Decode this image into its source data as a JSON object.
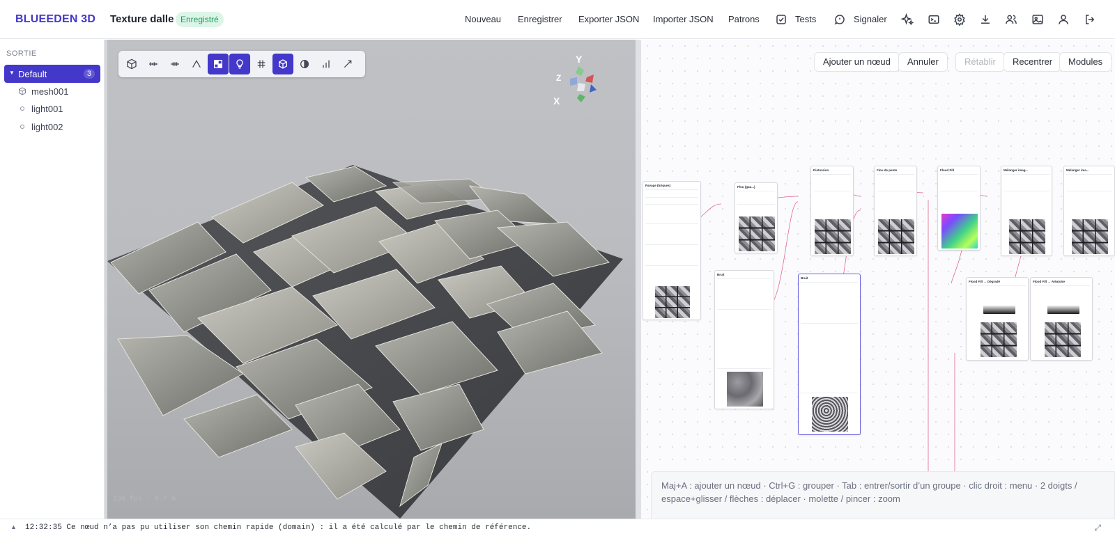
{
  "app": {
    "brand": "BLUEEDEN 3D",
    "document_title": "Texture dalle",
    "save_status": "Enregistré"
  },
  "menu": {
    "items": [
      "Nouveau",
      "Enregistrer",
      "Exporter JSON",
      "Importer JSON",
      "Patrons"
    ],
    "tests_label": "Tests",
    "report_label": "Signaler"
  },
  "toolbar_icons": [
    "sparkles-icon",
    "terminal-icon",
    "gear-icon",
    "download-icon",
    "users-icon",
    "image-icon",
    "user-icon",
    "logout-icon"
  ],
  "sidebar": {
    "section_label": "SORTIE",
    "scene": {
      "name": "Default",
      "count": "3"
    },
    "items": [
      {
        "label": "mesh001",
        "icon": "cube-icon"
      },
      {
        "label": "light001",
        "icon": "light-dot-icon"
      },
      {
        "label": "light002",
        "icon": "light-dot-icon"
      }
    ]
  },
  "viewport": {
    "tools": [
      "cube-icon",
      "ruler-icon",
      "grid-lines-icon",
      "angle-icon",
      "checker-icon",
      "bulb-icon",
      "grid-icon",
      "box-icon",
      "contrast-icon",
      "bars-icon",
      "diagonal-icon"
    ],
    "active_tools": [
      "checker-icon",
      "bulb-icon",
      "box-icon"
    ],
    "gizmo": {
      "x": "X",
      "y": "Y",
      "z": "Z"
    },
    "status_text": "130 fps · 0.7 m"
  },
  "graph": {
    "buttons": {
      "add": "Ajouter un nœud",
      "undo": "Annuler",
      "redo": "Rétablir",
      "recenter": "Recentrer",
      "modules": "Modules"
    },
    "hint": "Maj+A : ajouter un nœud · Ctrl+G : grouper · Tab : entrer/sortir d’un groupe · clic droit : menu · 2 doigts / espace+glisser / flèches : déplacer · molette / pincer : zoom",
    "nodes": [
      {
        "title": "Pavage (briques)"
      },
      {
        "title": "Flou (gau...)"
      },
      {
        "title": "Distorsion"
      },
      {
        "title": "Flou de pente"
      },
      {
        "title": "Flood Fill"
      },
      {
        "title": "Mélanger imag..."
      },
      {
        "title": "Mélanger ima..."
      },
      {
        "title": "Bruit"
      },
      {
        "title": "Bruit"
      },
      {
        "title": "Flood Fill → Dégradé"
      },
      {
        "title": "Flood Fill → Aléatoire"
      }
    ]
  },
  "status": {
    "message": "12:32:35 Ce nœud n’a pas pu utiliser son chemin rapide (domain) : il a été calculé par le chemin de référence."
  }
}
